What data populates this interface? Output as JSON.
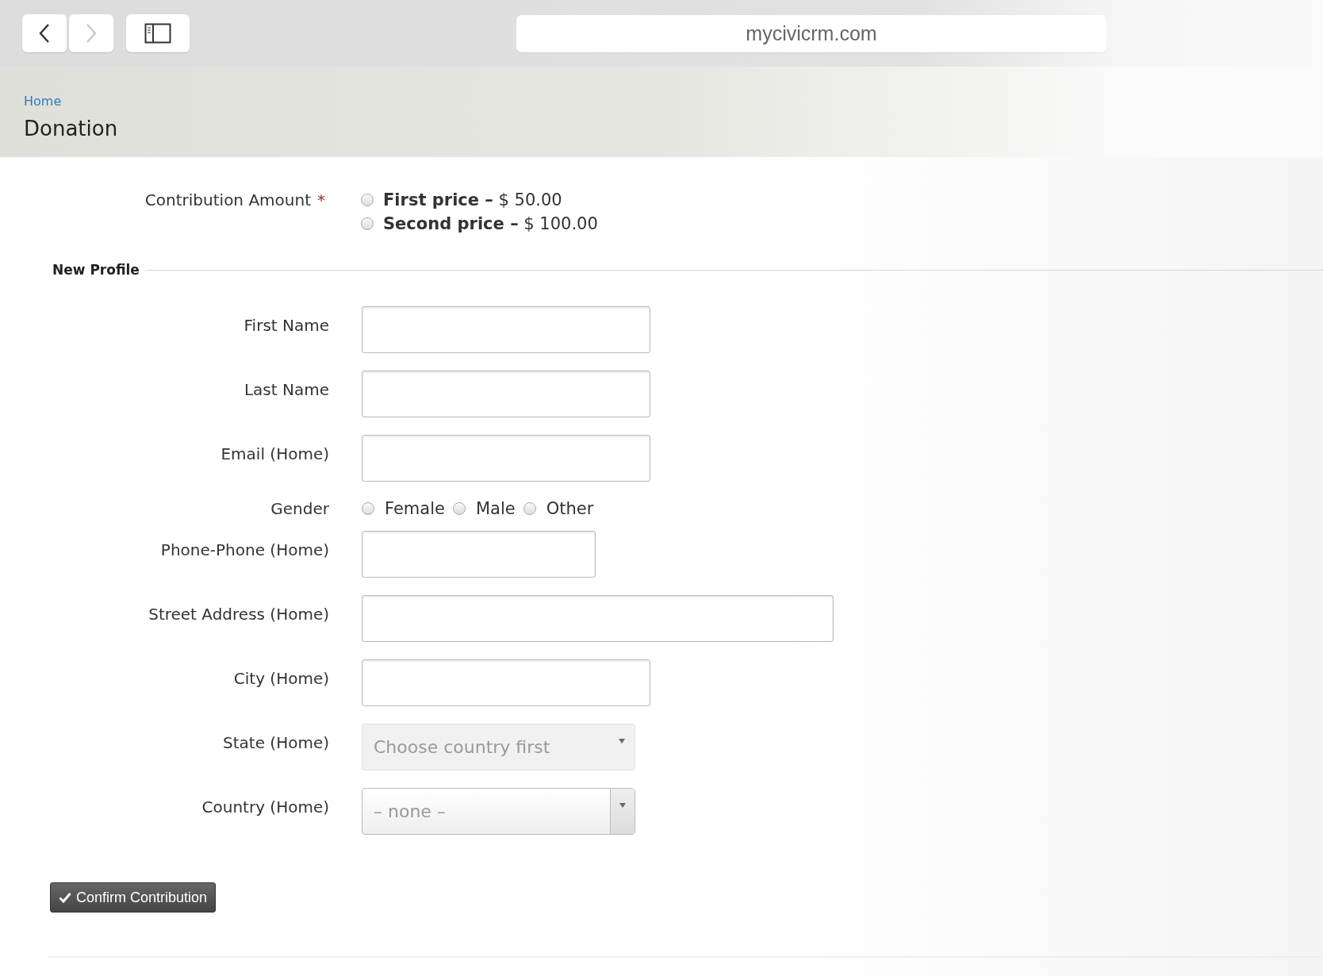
{
  "browser": {
    "url": "mycivicrm.com"
  },
  "breadcrumb": {
    "label": "Home"
  },
  "page_title": "Donation",
  "contribution": {
    "label": "Contribution Amount",
    "required_mark": "*",
    "options": [
      {
        "label": "**First price –** $ 50.00",
        "selected": false
      },
      {
        "label": "**Second price –** $ 100.00",
        "selected": false
      }
    ]
  },
  "section": {
    "title": "New Profile"
  },
  "fields": [
    {
      "kind": "text",
      "label": "First Name"
    },
    {
      "kind": "text",
      "label": "Last Name"
    },
    {
      "kind": "text",
      "label": "Email (Home)"
    },
    {
      "kind": "radio",
      "label": "Gender",
      "options": [
        {
          "label": "Female",
          "selected": false
        },
        {
          "label": "Male",
          "selected": false
        },
        {
          "label": "Other",
          "selected": false
        }
      ]
    },
    {
      "kind": "phone",
      "label": "Phone-Phone (Home)"
    },
    {
      "kind": "street",
      "label": "Street Address (Home)"
    },
    {
      "kind": "text",
      "label": "City (Home)"
    },
    {
      "kind": "select",
      "label": "State (Home)",
      "value": "Choose country first",
      "disabled": true
    },
    {
      "kind": "select",
      "label": "Country (Home)",
      "value": "– none –",
      "disabled": false
    }
  ],
  "submit": {
    "label": "Confirm Contribution"
  }
}
